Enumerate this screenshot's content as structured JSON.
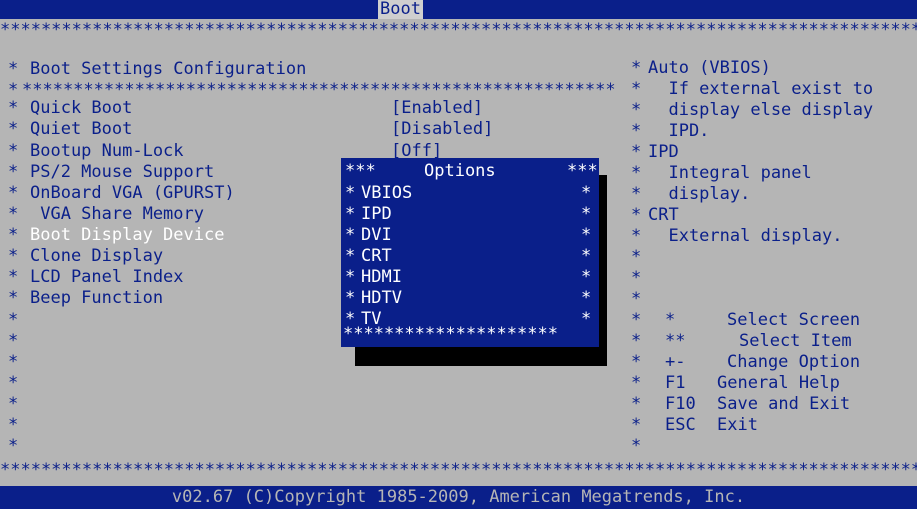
{
  "header": {
    "tab": "Boot"
  },
  "left": {
    "title": "Boot Settings Configuration",
    "items": [
      {
        "label": "Quick Boot",
        "value": "[Enabled]"
      },
      {
        "label": "Quiet Boot",
        "value": "[Disabled]"
      },
      {
        "label": "Bootup Num-Lock",
        "value": "[Off]"
      },
      {
        "label": "PS/2 Mouse Support",
        "value": ""
      },
      {
        "label": "OnBoard VGA (GPURST)",
        "value": ""
      },
      {
        "label": " VGA Share Memory",
        "value": ""
      },
      {
        "label": "Boot Display Device",
        "value": ""
      },
      {
        "label": "Clone Display",
        "value": ""
      },
      {
        "label": "LCD Panel Index",
        "value": ""
      },
      {
        "label": "Beep Function",
        "value": ""
      }
    ]
  },
  "popup": {
    "title": "Options",
    "options": [
      "VBIOS",
      "IPD",
      "DVI",
      "CRT",
      "HDMI",
      "HDTV",
      "TV"
    ],
    "selected": "CRT"
  },
  "help": {
    "lines": [
      "Auto (VBIOS)",
      "  If external exist to",
      "  display else display",
      "  IPD.",
      "IPD",
      "  Integral panel",
      "  display.",
      "CRT",
      "  External display."
    ],
    "keys": [
      {
        "key": "*",
        "desc": "Select Screen"
      },
      {
        "key": "**",
        "desc": "Select Item"
      },
      {
        "key": "+-",
        "desc": "Change Option"
      },
      {
        "key": "F1",
        "desc": "General Help"
      },
      {
        "key": "F10",
        "desc": "Save and Exit"
      },
      {
        "key": "ESC",
        "desc": "Exit"
      }
    ]
  },
  "footer": {
    "text": "v02.67 (C)Copyright 1985-2009, American Megatrends, Inc."
  }
}
